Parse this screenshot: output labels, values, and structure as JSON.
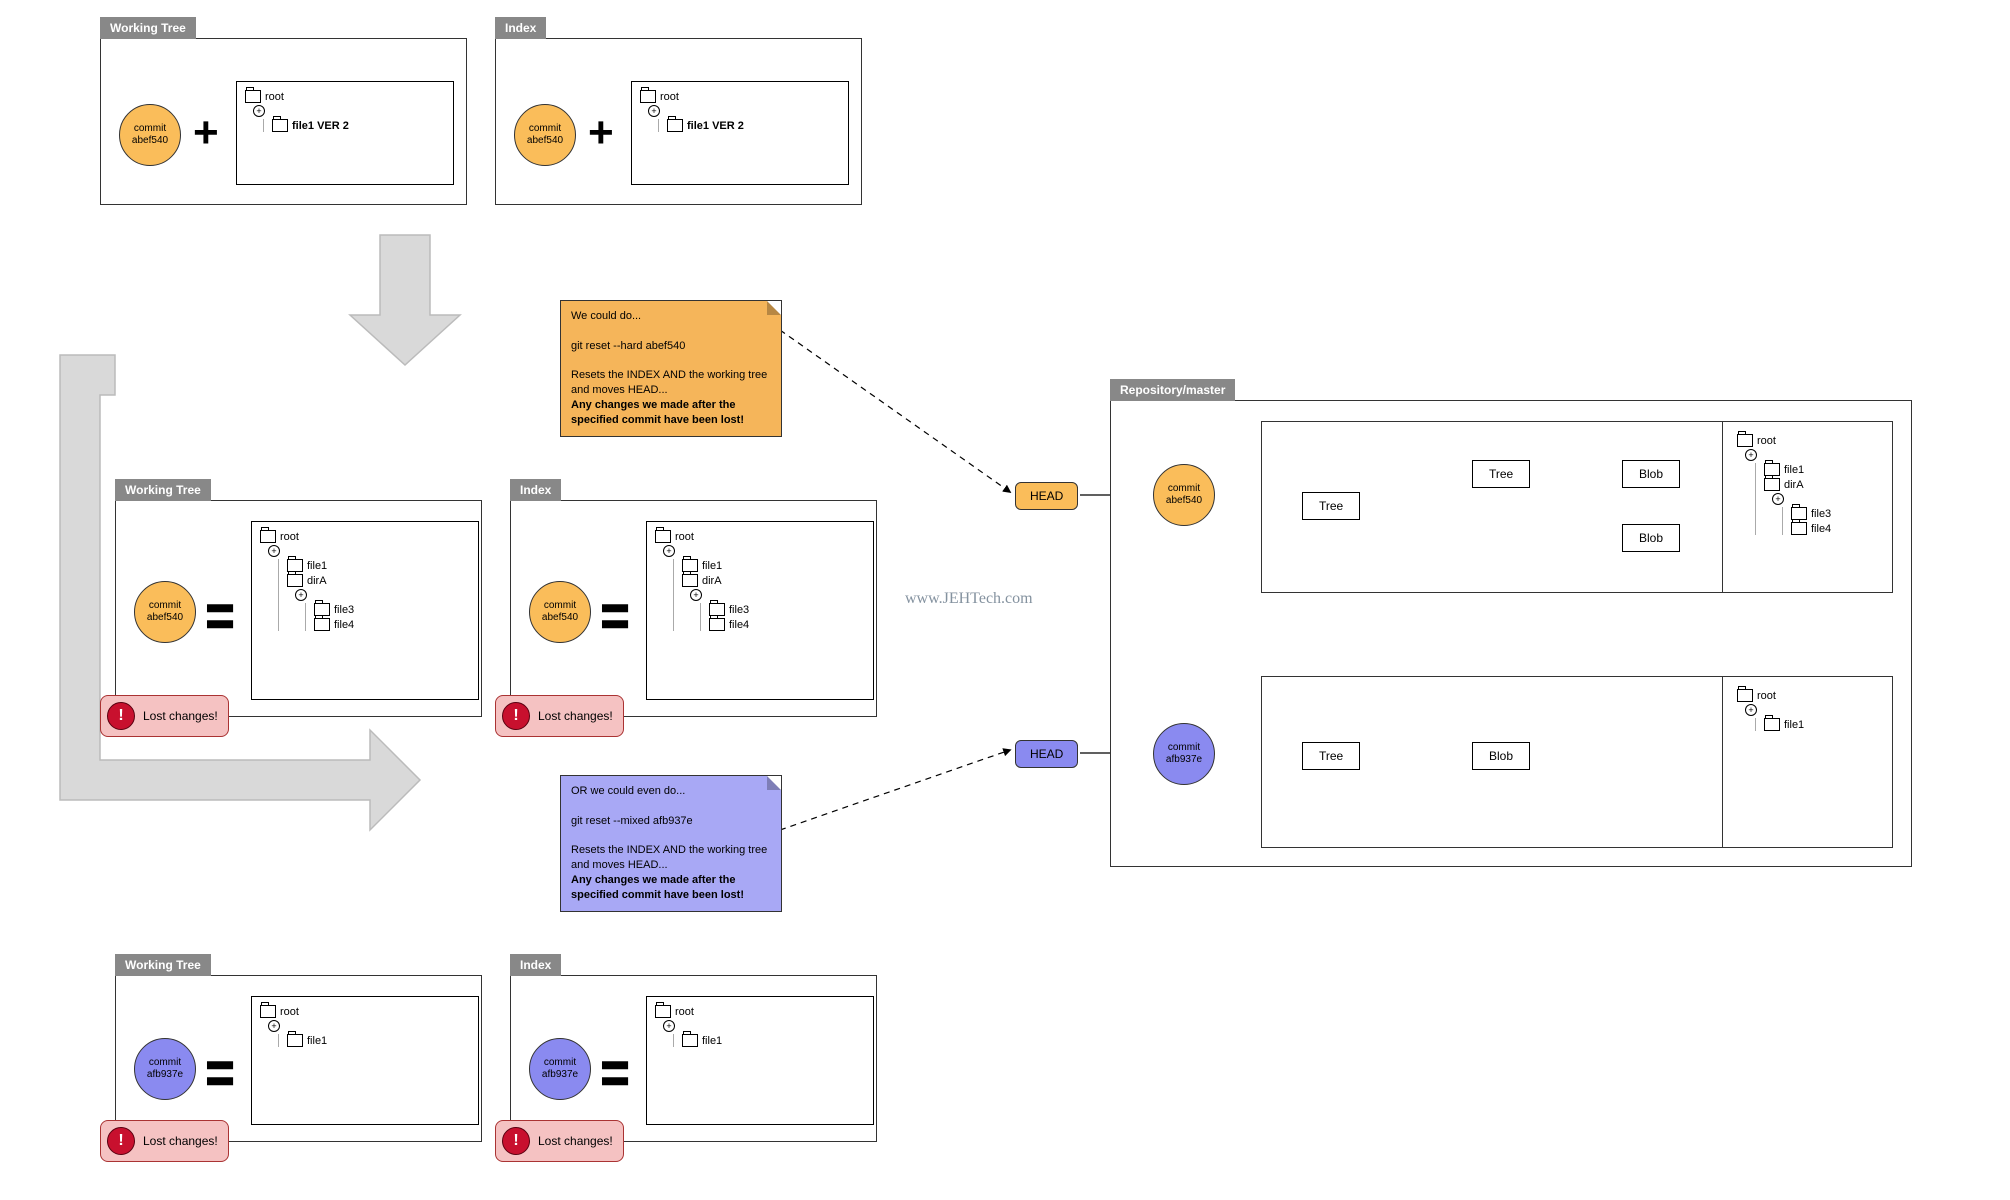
{
  "labels": {
    "working_tree": "Working Tree",
    "index": "Index",
    "repository": "Repository/master",
    "head": "HEAD",
    "tree": "Tree",
    "blob": "Blob",
    "lost_changes": "Lost changes!",
    "commit": "commit"
  },
  "commits": {
    "orange": "abef540",
    "purple": "afb937e"
  },
  "files": {
    "root": "root",
    "file1": "file1",
    "file1_v2": "file1 VER 2",
    "dirA": "dirA",
    "file3": "file3",
    "file4": "file4"
  },
  "notes": {
    "orange": {
      "l1": "We could do...",
      "l2": "git reset --hard abef540",
      "l3": "Resets the INDEX AND the working tree and moves HEAD...",
      "l4": "Any changes we made after the specified commit have been lost!"
    },
    "purple": {
      "l1": "OR we could even do...",
      "l2": "git reset --mixed afb937e",
      "l3": "Resets the INDEX AND the working tree and moves HEAD...",
      "l4": "Any changes we made after the specified commit have been lost!"
    }
  },
  "watermark": "www.JEHTech.com"
}
